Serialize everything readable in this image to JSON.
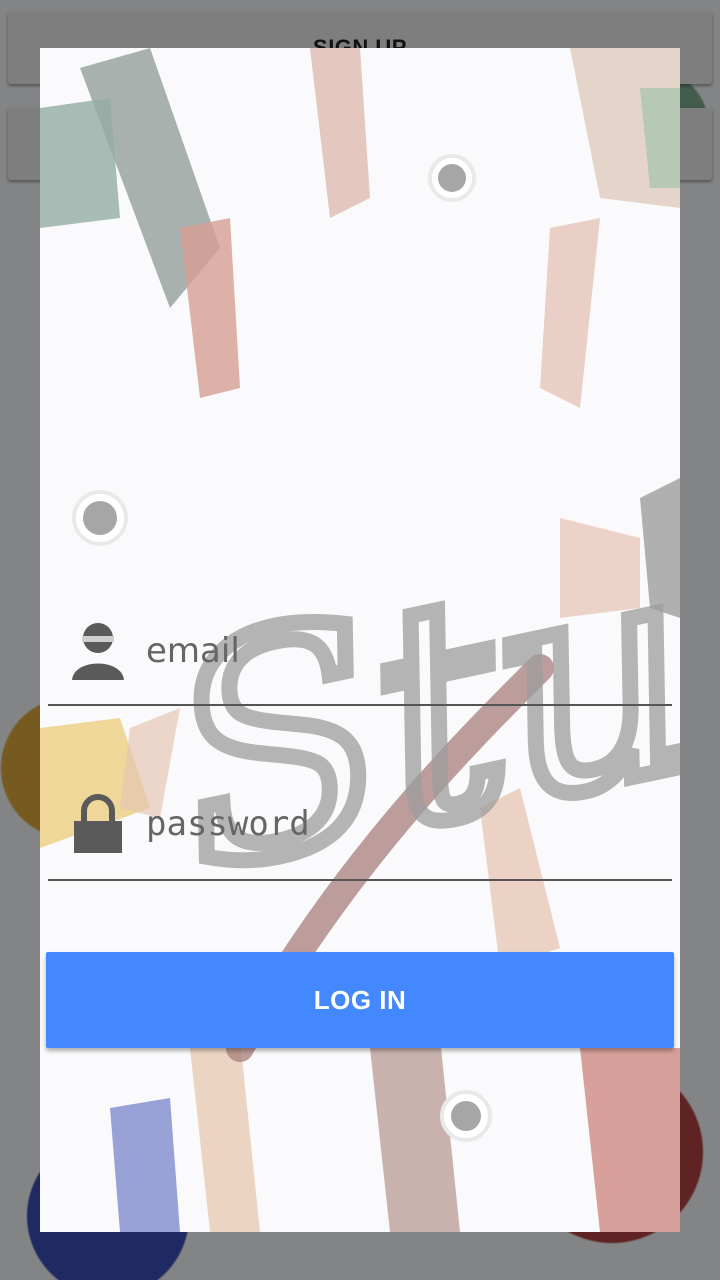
{
  "background_page": {
    "signup_label": "SIGN UP",
    "second_button_label": ""
  },
  "dialog": {
    "background_image_text": "Study",
    "email": {
      "placeholder": "email",
      "value": "",
      "icon": "person-icon"
    },
    "password": {
      "placeholder": "password",
      "value": "",
      "icon": "lock-icon"
    },
    "login_label": "LOG IN"
  },
  "colors": {
    "login_button": "#4488ff",
    "scrim": "rgba(0,0,0,0.45)"
  }
}
